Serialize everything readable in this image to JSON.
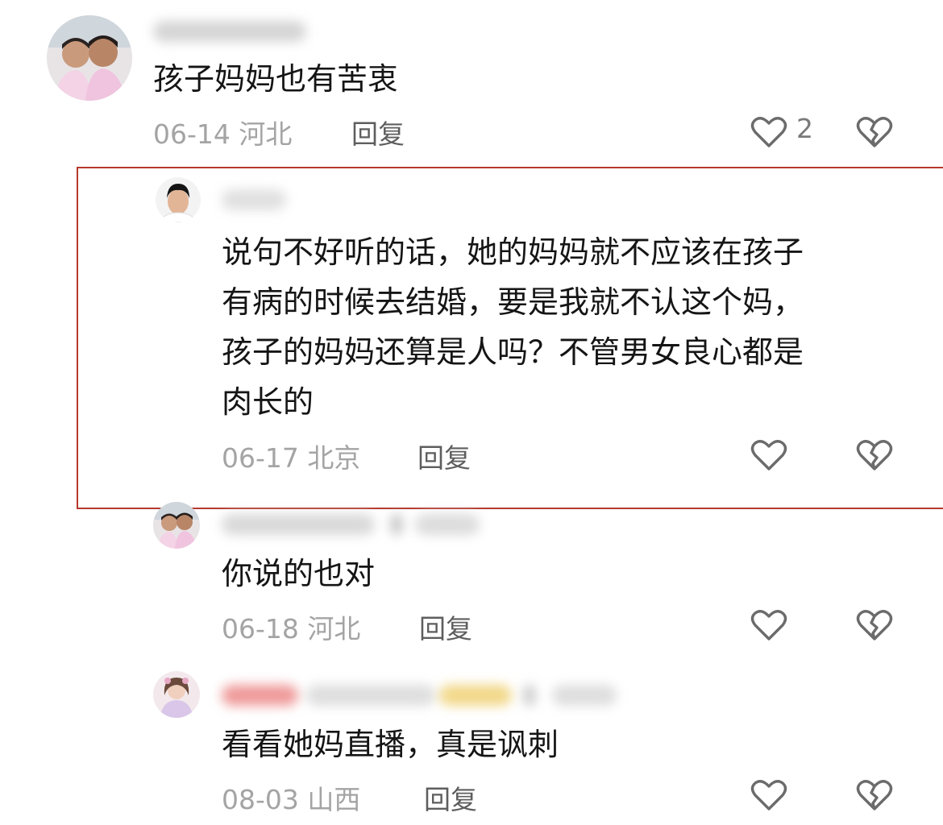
{
  "comments": [
    {
      "text_lines": [
        "孩子妈妈也有苦衷"
      ],
      "date": "06-14",
      "location": "河北",
      "reply_label": "回复",
      "like_count": "2"
    },
    {
      "text_lines": [
        "说句不好听的话，她的妈妈就不应该在孩子",
        "有病的时候去结婚，要是我就不认这个妈，",
        "孩子的妈妈还算是人吗？不管男女良心都是",
        "肉长的"
      ],
      "date": "06-17",
      "location": "北京",
      "reply_label": "回复"
    },
    {
      "text_lines": [
        "你说的也对"
      ],
      "date": "06-18",
      "location": "河北",
      "reply_label": "回复"
    },
    {
      "text_lines": [
        "看看她妈直播，真是讽刺"
      ],
      "date": "08-03",
      "location": "山西",
      "reply_label": "回复"
    }
  ],
  "icons": {
    "like": "heart-outline-icon",
    "dislike": "broken-heart-icon"
  },
  "colors": {
    "highlight_border": "#b5392c",
    "meta_text": "#a4a4a4",
    "icon_stroke": "#6b6b6b"
  }
}
